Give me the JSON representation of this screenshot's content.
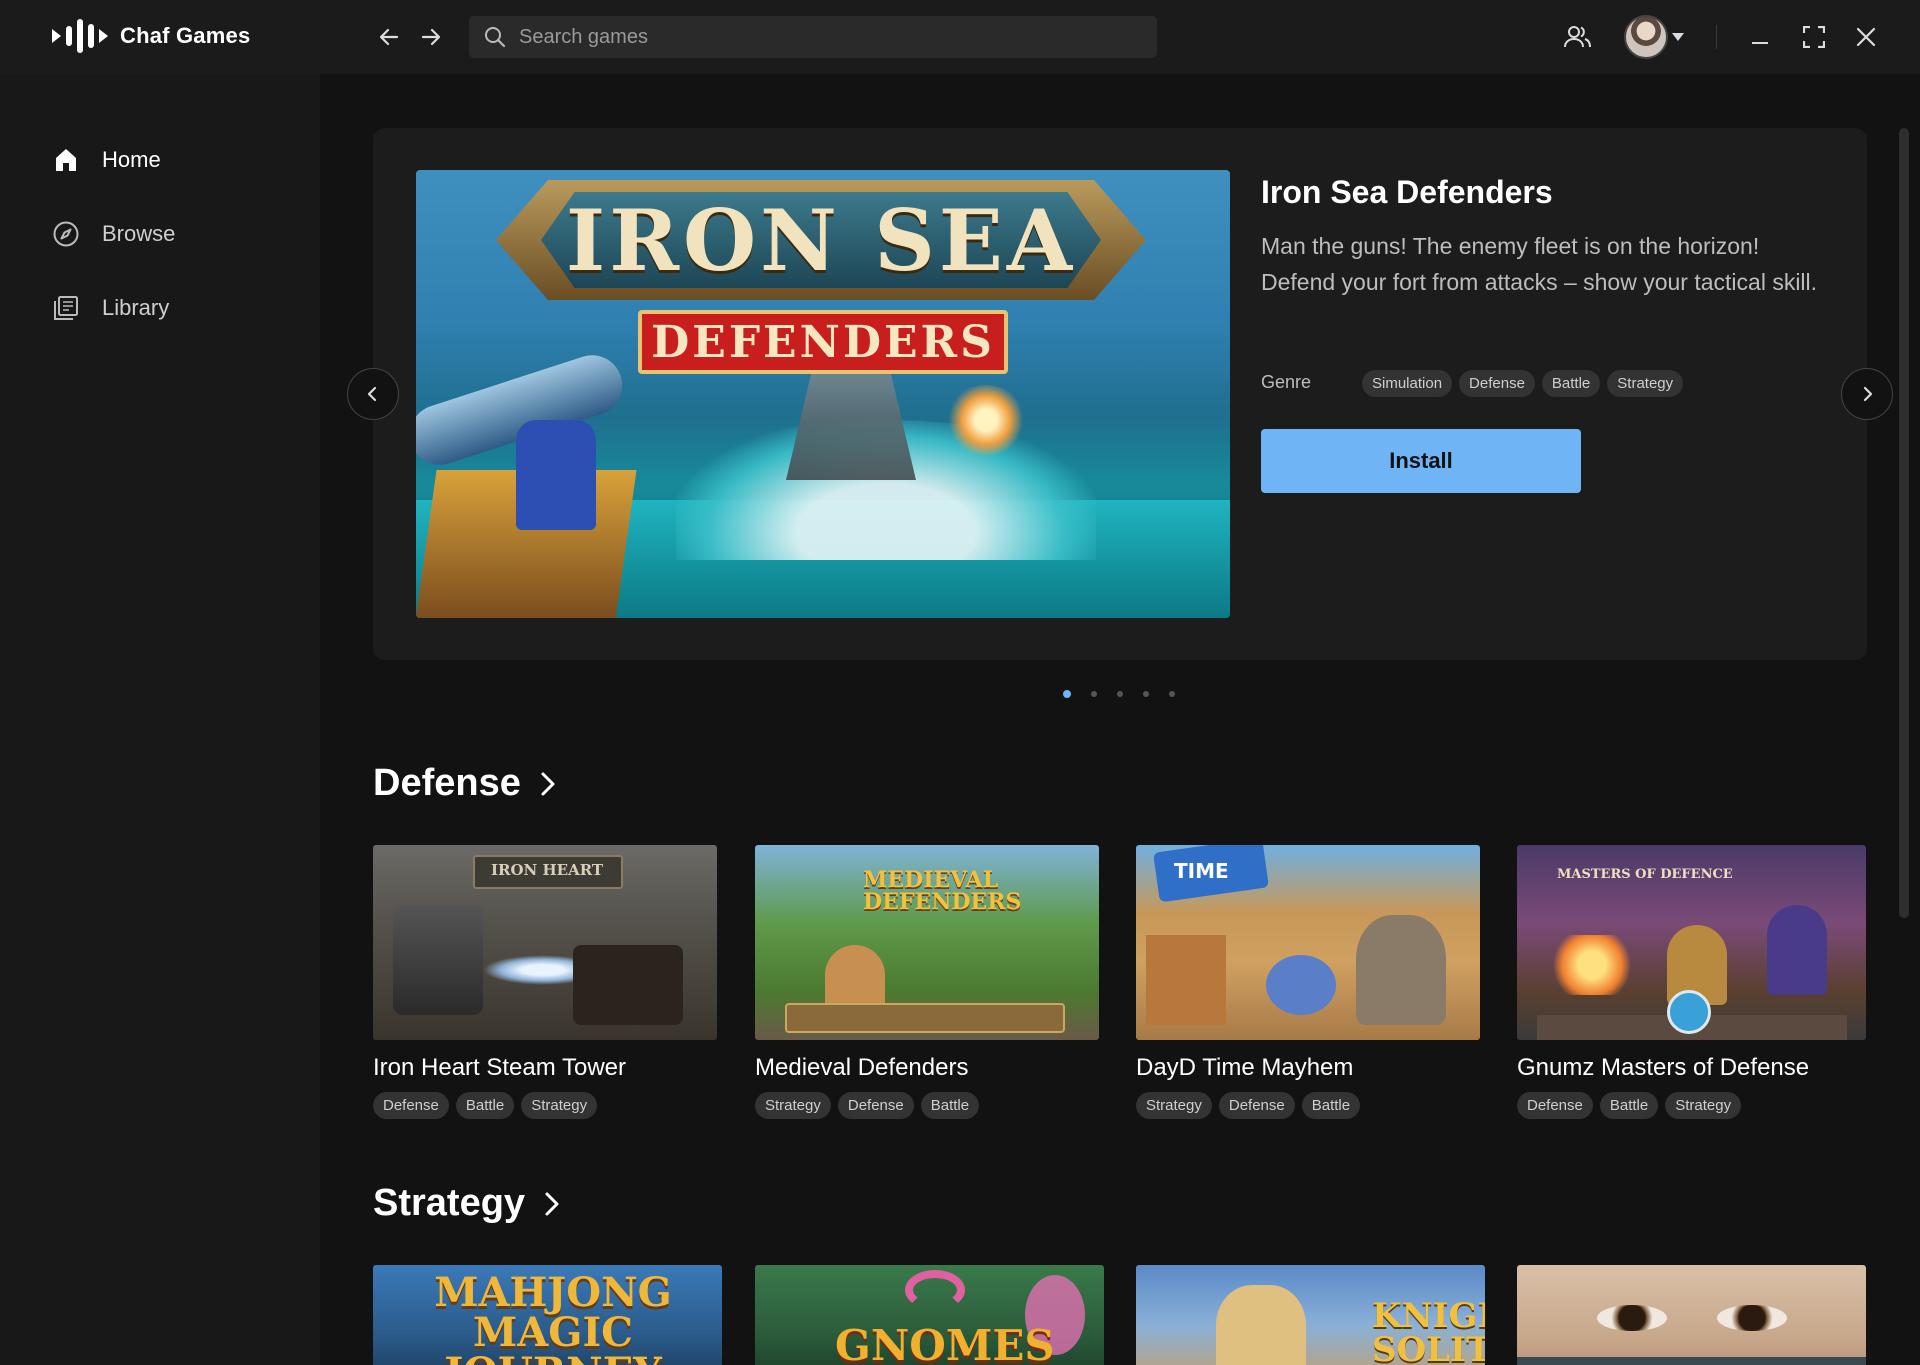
{
  "app": {
    "name": "Chaf Games"
  },
  "search": {
    "placeholder": "Search games"
  },
  "sidebar": {
    "items": [
      {
        "label": "Home",
        "icon": "home-icon"
      },
      {
        "label": "Browse",
        "icon": "compass-icon"
      },
      {
        "label": "Library",
        "icon": "library-icon"
      }
    ]
  },
  "hero": {
    "title": "Iron Sea Defenders",
    "description": "Man the guns! The enemy fleet is on the horizon! Defend your fort from attacks – show your tactical skill.",
    "art_title": "IRON SEA",
    "art_subtitle": "DEFENDERS",
    "genre_label": "Genre",
    "tags": [
      "Simulation",
      "Defense",
      "Battle",
      "Strategy"
    ],
    "install_label": "Install",
    "carousel_pages": 5,
    "carousel_active": 1
  },
  "sections": [
    {
      "title": "Defense",
      "games": [
        {
          "name": "Iron Heart Steam Tower",
          "art": "IRON HEART",
          "tags": [
            "Defense",
            "Battle",
            "Strategy"
          ]
        },
        {
          "name": "Medieval Defenders",
          "art": "MEDIEVAL DEFENDERS",
          "tags": [
            "Strategy",
            "Defense",
            "Battle"
          ]
        },
        {
          "name": "DayD Time Mayhem",
          "art": "TIME",
          "tags": [
            "Strategy",
            "Defense",
            "Battle"
          ]
        },
        {
          "name": "Gnumz Masters of Defense",
          "art": "MASTERS OF DEFENCE",
          "tags": [
            "Defense",
            "Battle",
            "Strategy"
          ]
        }
      ]
    },
    {
      "title": "Strategy",
      "games": [
        {
          "art": "MAHJONG MAGIC JOURNEY"
        },
        {
          "art": "GNOMES"
        },
        {
          "art": "KNIGHT SOLITAIRE"
        },
        {
          "art": ""
        }
      ]
    }
  ],
  "colors": {
    "accent": "#6fb4f5",
    "background": "#121212",
    "sidebar": "#181818",
    "titlebar": "#1b1b1b"
  }
}
